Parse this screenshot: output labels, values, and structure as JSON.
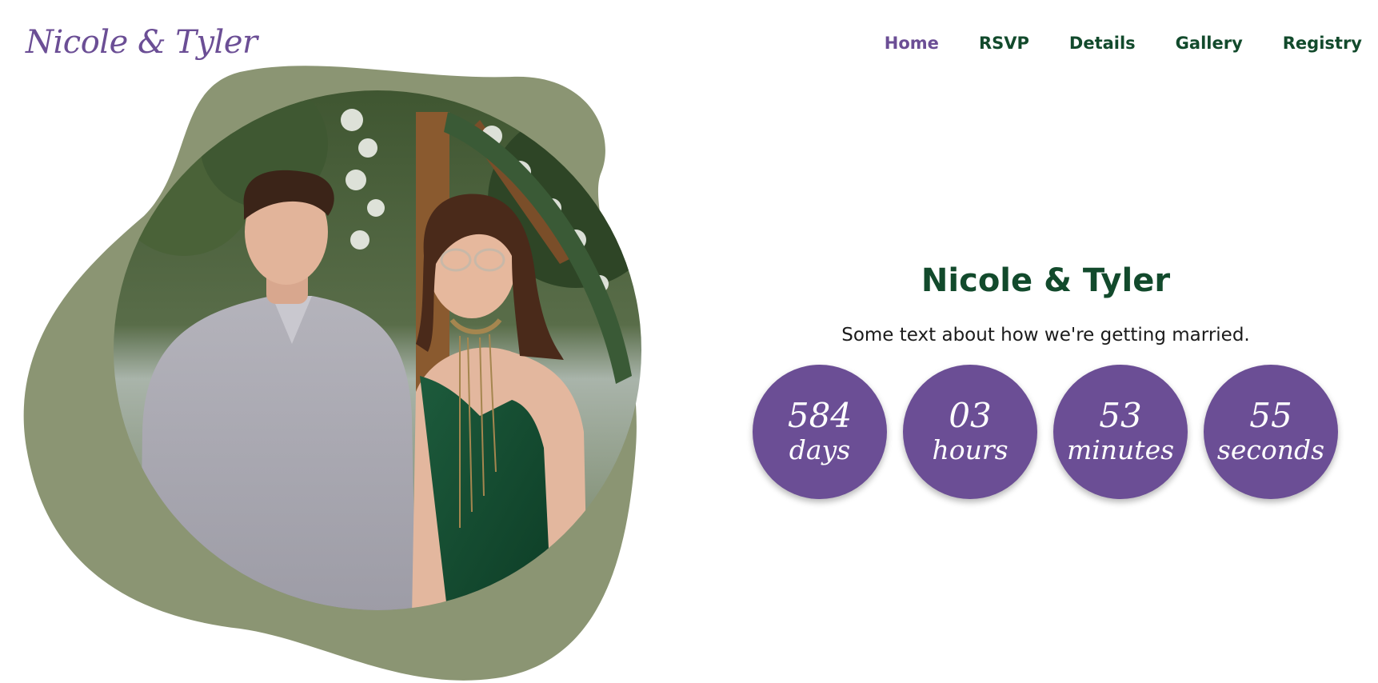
{
  "header": {
    "logo_text": "Nicole & Tyler",
    "nav": [
      {
        "label": "Home",
        "active": true
      },
      {
        "label": "RSVP",
        "active": false
      },
      {
        "label": "Details",
        "active": false
      },
      {
        "label": "Gallery",
        "active": false
      },
      {
        "label": "Registry",
        "active": false
      }
    ]
  },
  "hero": {
    "title": "Nicole & Tyler",
    "subtitle": "Some text about how we're getting married."
  },
  "countdown": [
    {
      "value": "584",
      "unit": "days"
    },
    {
      "value": "03",
      "unit": "hours"
    },
    {
      "value": "53",
      "unit": "minutes"
    },
    {
      "value": "55",
      "unit": "seconds"
    }
  ],
  "colors": {
    "brand_purple": "#6b4e95",
    "brand_green": "#124a2c",
    "blob_sage": "#8b9573"
  }
}
